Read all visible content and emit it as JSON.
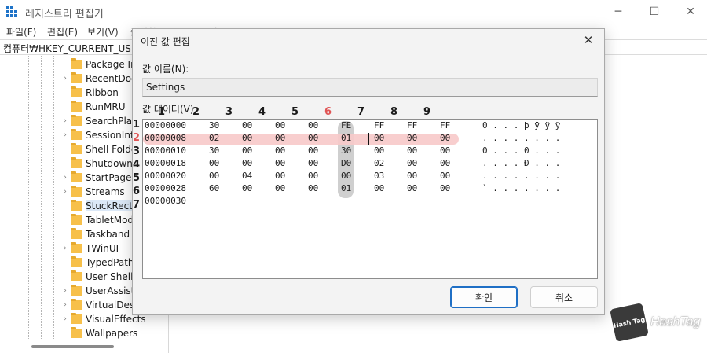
{
  "window": {
    "title": "레지스트리 편집기",
    "controls": {
      "minimize": "─",
      "maximize": "☐",
      "close": "✕"
    }
  },
  "menubar": [
    "파일(F)",
    "편집(E)",
    "보기(V)",
    "즐겨찾기(A)",
    "도움말(H)"
  ],
  "address": "컴퓨터₩HKEY_CURRENT_USER₩",
  "tree": {
    "items": [
      {
        "label": "Package In",
        "expandable": false,
        "selected": false
      },
      {
        "label": "RecentDoc",
        "expandable": true,
        "selected": false
      },
      {
        "label": "Ribbon",
        "expandable": false,
        "selected": false
      },
      {
        "label": "RunMRU",
        "expandable": false,
        "selected": false
      },
      {
        "label": "SearchPlatf",
        "expandable": true,
        "selected": false
      },
      {
        "label": "SessionInfo",
        "expandable": true,
        "selected": false
      },
      {
        "label": "Shell Folde",
        "expandable": false,
        "selected": false
      },
      {
        "label": "Shutdown",
        "expandable": false,
        "selected": false
      },
      {
        "label": "StartPage",
        "expandable": true,
        "selected": false
      },
      {
        "label": "Streams",
        "expandable": true,
        "selected": false
      },
      {
        "label": "StuckRects",
        "expandable": false,
        "selected": true
      },
      {
        "label": "TabletMode",
        "expandable": false,
        "selected": false
      },
      {
        "label": "Taskband",
        "expandable": false,
        "selected": false
      },
      {
        "label": "TWinUI",
        "expandable": true,
        "selected": false
      },
      {
        "label": "TypedPaths",
        "expandable": false,
        "selected": false
      },
      {
        "label": "User Shell",
        "expandable": false,
        "selected": false
      },
      {
        "label": "UserAssist",
        "expandable": true,
        "selected": false
      },
      {
        "label": "VirtualDesk",
        "expandable": true,
        "selected": false
      },
      {
        "label": "VisualEffects",
        "expandable": true,
        "selected": false
      },
      {
        "label": "Wallpapers",
        "expandable": false,
        "selected": false
      }
    ]
  },
  "dialog": {
    "title": "이진 값 편집",
    "close": "✕",
    "name_label": "값 이름(N):",
    "name_value": "Settings",
    "data_label": "값 데이터(V):",
    "ok_label": "확인",
    "cancel_label": "취소",
    "column_markers": [
      "1",
      "2",
      "3",
      "4",
      "5",
      "6",
      "7",
      "8",
      "9"
    ],
    "row_markers": [
      "1",
      "2",
      "3",
      "4",
      "5",
      "6",
      "7"
    ],
    "highlighted_column": 6,
    "highlighted_row": 2,
    "rows": [
      {
        "offset": "00000000",
        "bytes": [
          "30",
          "00",
          "00",
          "00",
          "FE",
          "FF",
          "FF",
          "FF"
        ],
        "ascii": "0 . . . þ ÿ ÿ ÿ"
      },
      {
        "offset": "00000008",
        "bytes": [
          "02",
          "00",
          "00",
          "00",
          "01",
          "00",
          "00",
          "00"
        ],
        "ascii": ". . . . . . . ."
      },
      {
        "offset": "00000010",
        "bytes": [
          "30",
          "00",
          "00",
          "00",
          "30",
          "00",
          "00",
          "00"
        ],
        "ascii": "0 . . . 0 . . ."
      },
      {
        "offset": "00000018",
        "bytes": [
          "00",
          "00",
          "00",
          "00",
          "D0",
          "02",
          "00",
          "00"
        ],
        "ascii": ". . . . Ð . . ."
      },
      {
        "offset": "00000020",
        "bytes": [
          "00",
          "04",
          "00",
          "00",
          "00",
          "03",
          "00",
          "00"
        ],
        "ascii": ". . . . . . . ."
      },
      {
        "offset": "00000028",
        "bytes": [
          "60",
          "00",
          "00",
          "00",
          "01",
          "00",
          "00",
          "00"
        ],
        "ascii": "` . . . . . . ."
      },
      {
        "offset": "00000030",
        "bytes": [],
        "ascii": ""
      }
    ]
  },
  "watermark": {
    "cube_text": "Hash Tag",
    "text": "HashTag"
  }
}
